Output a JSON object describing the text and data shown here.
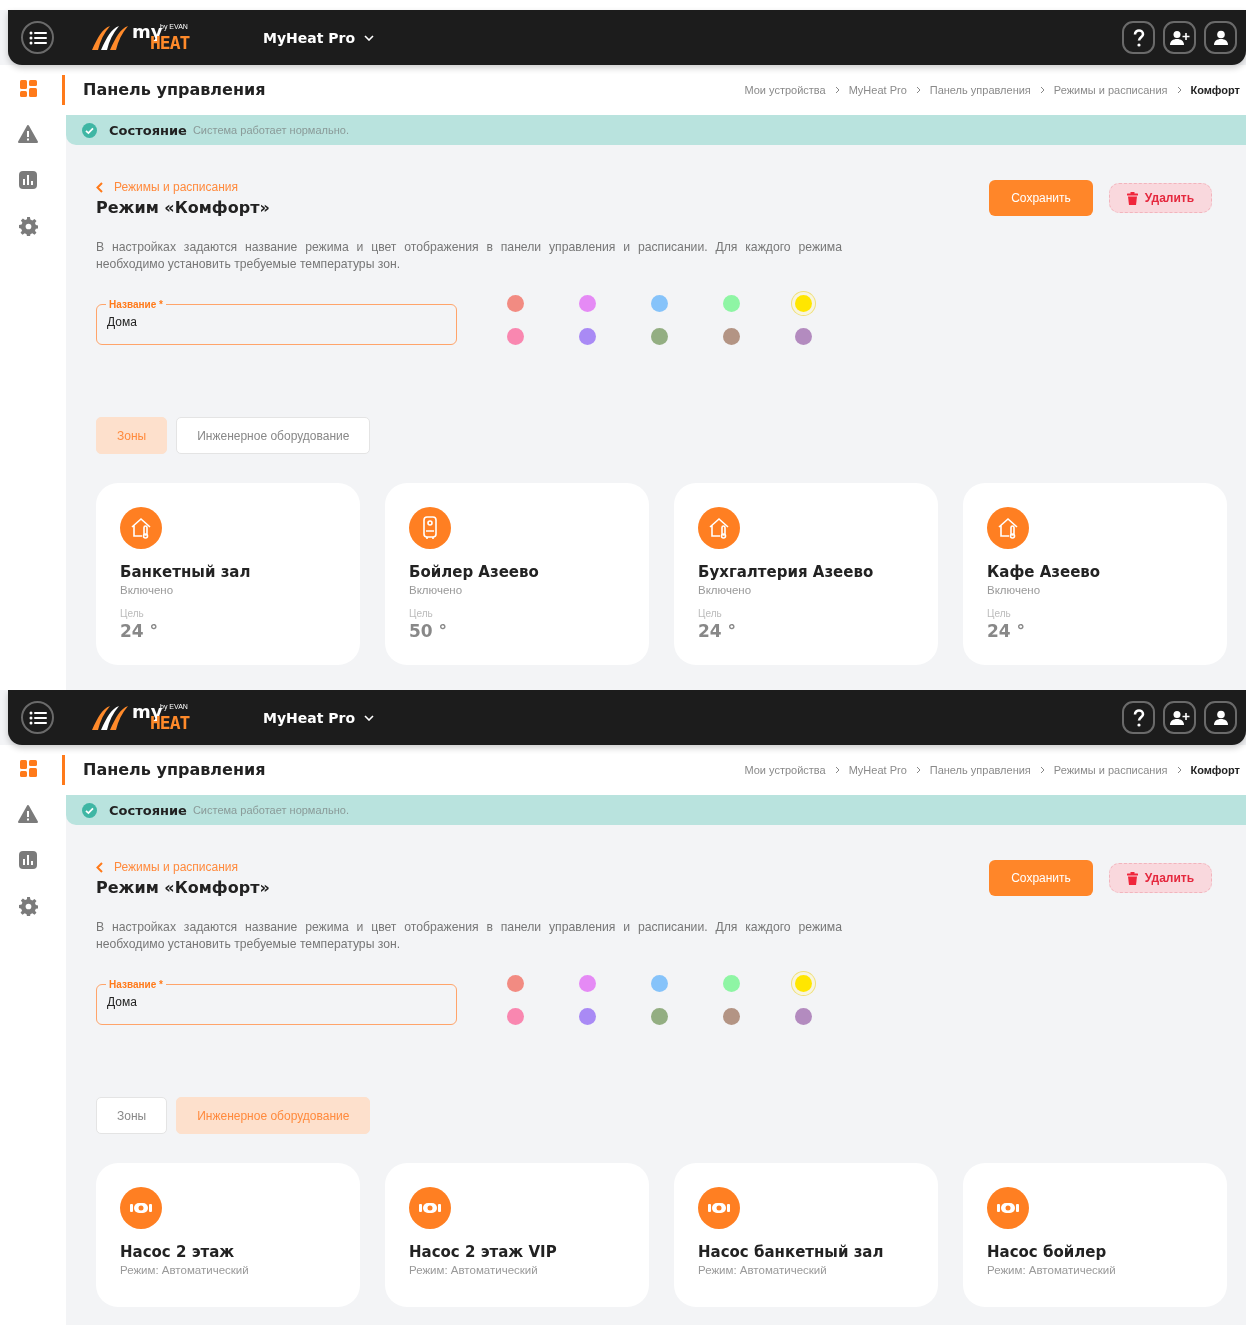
{
  "screens": [
    {
      "logo": {
        "top": "my",
        "by": "by EVAN",
        "bottom": "HEAT"
      },
      "app_title": "MyHeat Pro",
      "sidebar": [
        {
          "kind": "dashboard",
          "selected": true
        },
        {
          "kind": "warning",
          "selected": false
        },
        {
          "kind": "chart",
          "selected": false
        },
        {
          "kind": "gear",
          "selected": false
        }
      ],
      "page_title": "Панель управления",
      "breadcrumbs": [
        "Мои устройства",
        "MyHeat Pro",
        "Панель управления",
        "Режимы и расписания",
        "Комфорт"
      ],
      "status": {
        "label": "Состояние",
        "text": "Система работает нормально."
      },
      "back_link": "Режимы и расписания",
      "title": "Режим «Комфорт»",
      "save": "Сохранить",
      "delete": "Удалить",
      "description": "В настройках задаются название режима и цвет отображения в панели управления и расписании. Для каждого режима необходимо установить требуемые температуры зон.",
      "name_field": {
        "label": "Название *",
        "value": "Дома"
      },
      "swatches": [
        {
          "color": "#f28b82",
          "selected": false
        },
        {
          "color": "#e58af5",
          "selected": false
        },
        {
          "color": "#86c3fa",
          "selected": false
        },
        {
          "color": "#8ef5a4",
          "selected": false
        },
        {
          "color": "#ffe600",
          "selected": true
        },
        {
          "color": "#f987b0",
          "selected": false
        },
        {
          "color": "#a98af5",
          "selected": false
        },
        {
          "color": "#93ae82",
          "selected": false
        },
        {
          "color": "#b39484",
          "selected": false
        },
        {
          "color": "#b38bbf",
          "selected": false
        }
      ],
      "tabs": [
        {
          "label": "Зоны",
          "selected": true
        },
        {
          "label": "Инженерное оборудование",
          "selected": false
        }
      ],
      "cards": [
        {
          "kind": "zone",
          "name": "Банкетный зал",
          "status": "Включено",
          "target_label": "Цель",
          "target": "24 °"
        },
        {
          "kind": "boiler",
          "name": "Бойлер Азеево",
          "status": "Включено",
          "target_label": "Цель",
          "target": "50 °"
        },
        {
          "kind": "zone",
          "name": "Бухгалтерия Азеево",
          "status": "Включено",
          "target_label": "Цель",
          "target": "24 °"
        },
        {
          "kind": "zone",
          "name": "Кафе Азеево",
          "status": "Включено",
          "target_label": "Цель",
          "target": "24 °"
        }
      ]
    },
    {
      "logo": {
        "top": "my",
        "by": "by EVAN",
        "bottom": "HEAT"
      },
      "app_title": "MyHeat Pro",
      "sidebar": [
        {
          "kind": "dashboard",
          "selected": true
        },
        {
          "kind": "warning",
          "selected": false
        },
        {
          "kind": "chart",
          "selected": false
        },
        {
          "kind": "gear",
          "selected": false
        }
      ],
      "page_title": "Панель управления",
      "breadcrumbs": [
        "Мои устройства",
        "MyHeat Pro",
        "Панель управления",
        "Режимы и расписания",
        "Комфорт"
      ],
      "status": {
        "label": "Состояние",
        "text": "Система работает нормально."
      },
      "back_link": "Режимы и расписания",
      "title": "Режим «Комфорт»",
      "save": "Сохранить",
      "delete": "Удалить",
      "description": "В настройках задаются название режима и цвет отображения в панели управления и расписании. Для каждого режима необходимо установить требуемые температуры зон.",
      "name_field": {
        "label": "Название *",
        "value": "Дома"
      },
      "swatches": [
        {
          "color": "#f28b82",
          "selected": false
        },
        {
          "color": "#e58af5",
          "selected": false
        },
        {
          "color": "#86c3fa",
          "selected": false
        },
        {
          "color": "#8ef5a4",
          "selected": false
        },
        {
          "color": "#ffe600",
          "selected": true
        },
        {
          "color": "#f987b0",
          "selected": false
        },
        {
          "color": "#a98af5",
          "selected": false
        },
        {
          "color": "#93ae82",
          "selected": false
        },
        {
          "color": "#b39484",
          "selected": false
        },
        {
          "color": "#b38bbf",
          "selected": false
        }
      ],
      "tabs": [
        {
          "label": "Зоны",
          "selected": false
        },
        {
          "label": "Инженерное оборудование",
          "selected": true
        }
      ],
      "cards": [
        {
          "kind": "pump",
          "name": "Насос 2 этаж",
          "mode": "Режим: Автоматический"
        },
        {
          "kind": "pump",
          "name": "Насос 2 этаж VIP",
          "mode": "Режим: Автоматический"
        },
        {
          "kind": "pump",
          "name": "Насос банкетный зал",
          "mode": "Режим: Автоматический"
        },
        {
          "kind": "pump",
          "name": "Насос бойлер",
          "mode": "Режим: Автоматический"
        }
      ]
    }
  ]
}
